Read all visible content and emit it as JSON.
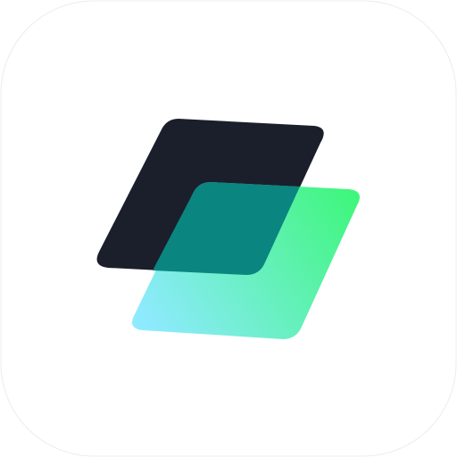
{
  "icon": {
    "name": "layered-parallelograms-logo",
    "colors": {
      "tile_background": "#ffffff",
      "tile_border": "#ececec",
      "back_shape": "#1b1f2b",
      "front_gradient_start": "#8eeaff",
      "front_gradient_end": "#3ff67c",
      "overlap": "#0b8580"
    }
  }
}
